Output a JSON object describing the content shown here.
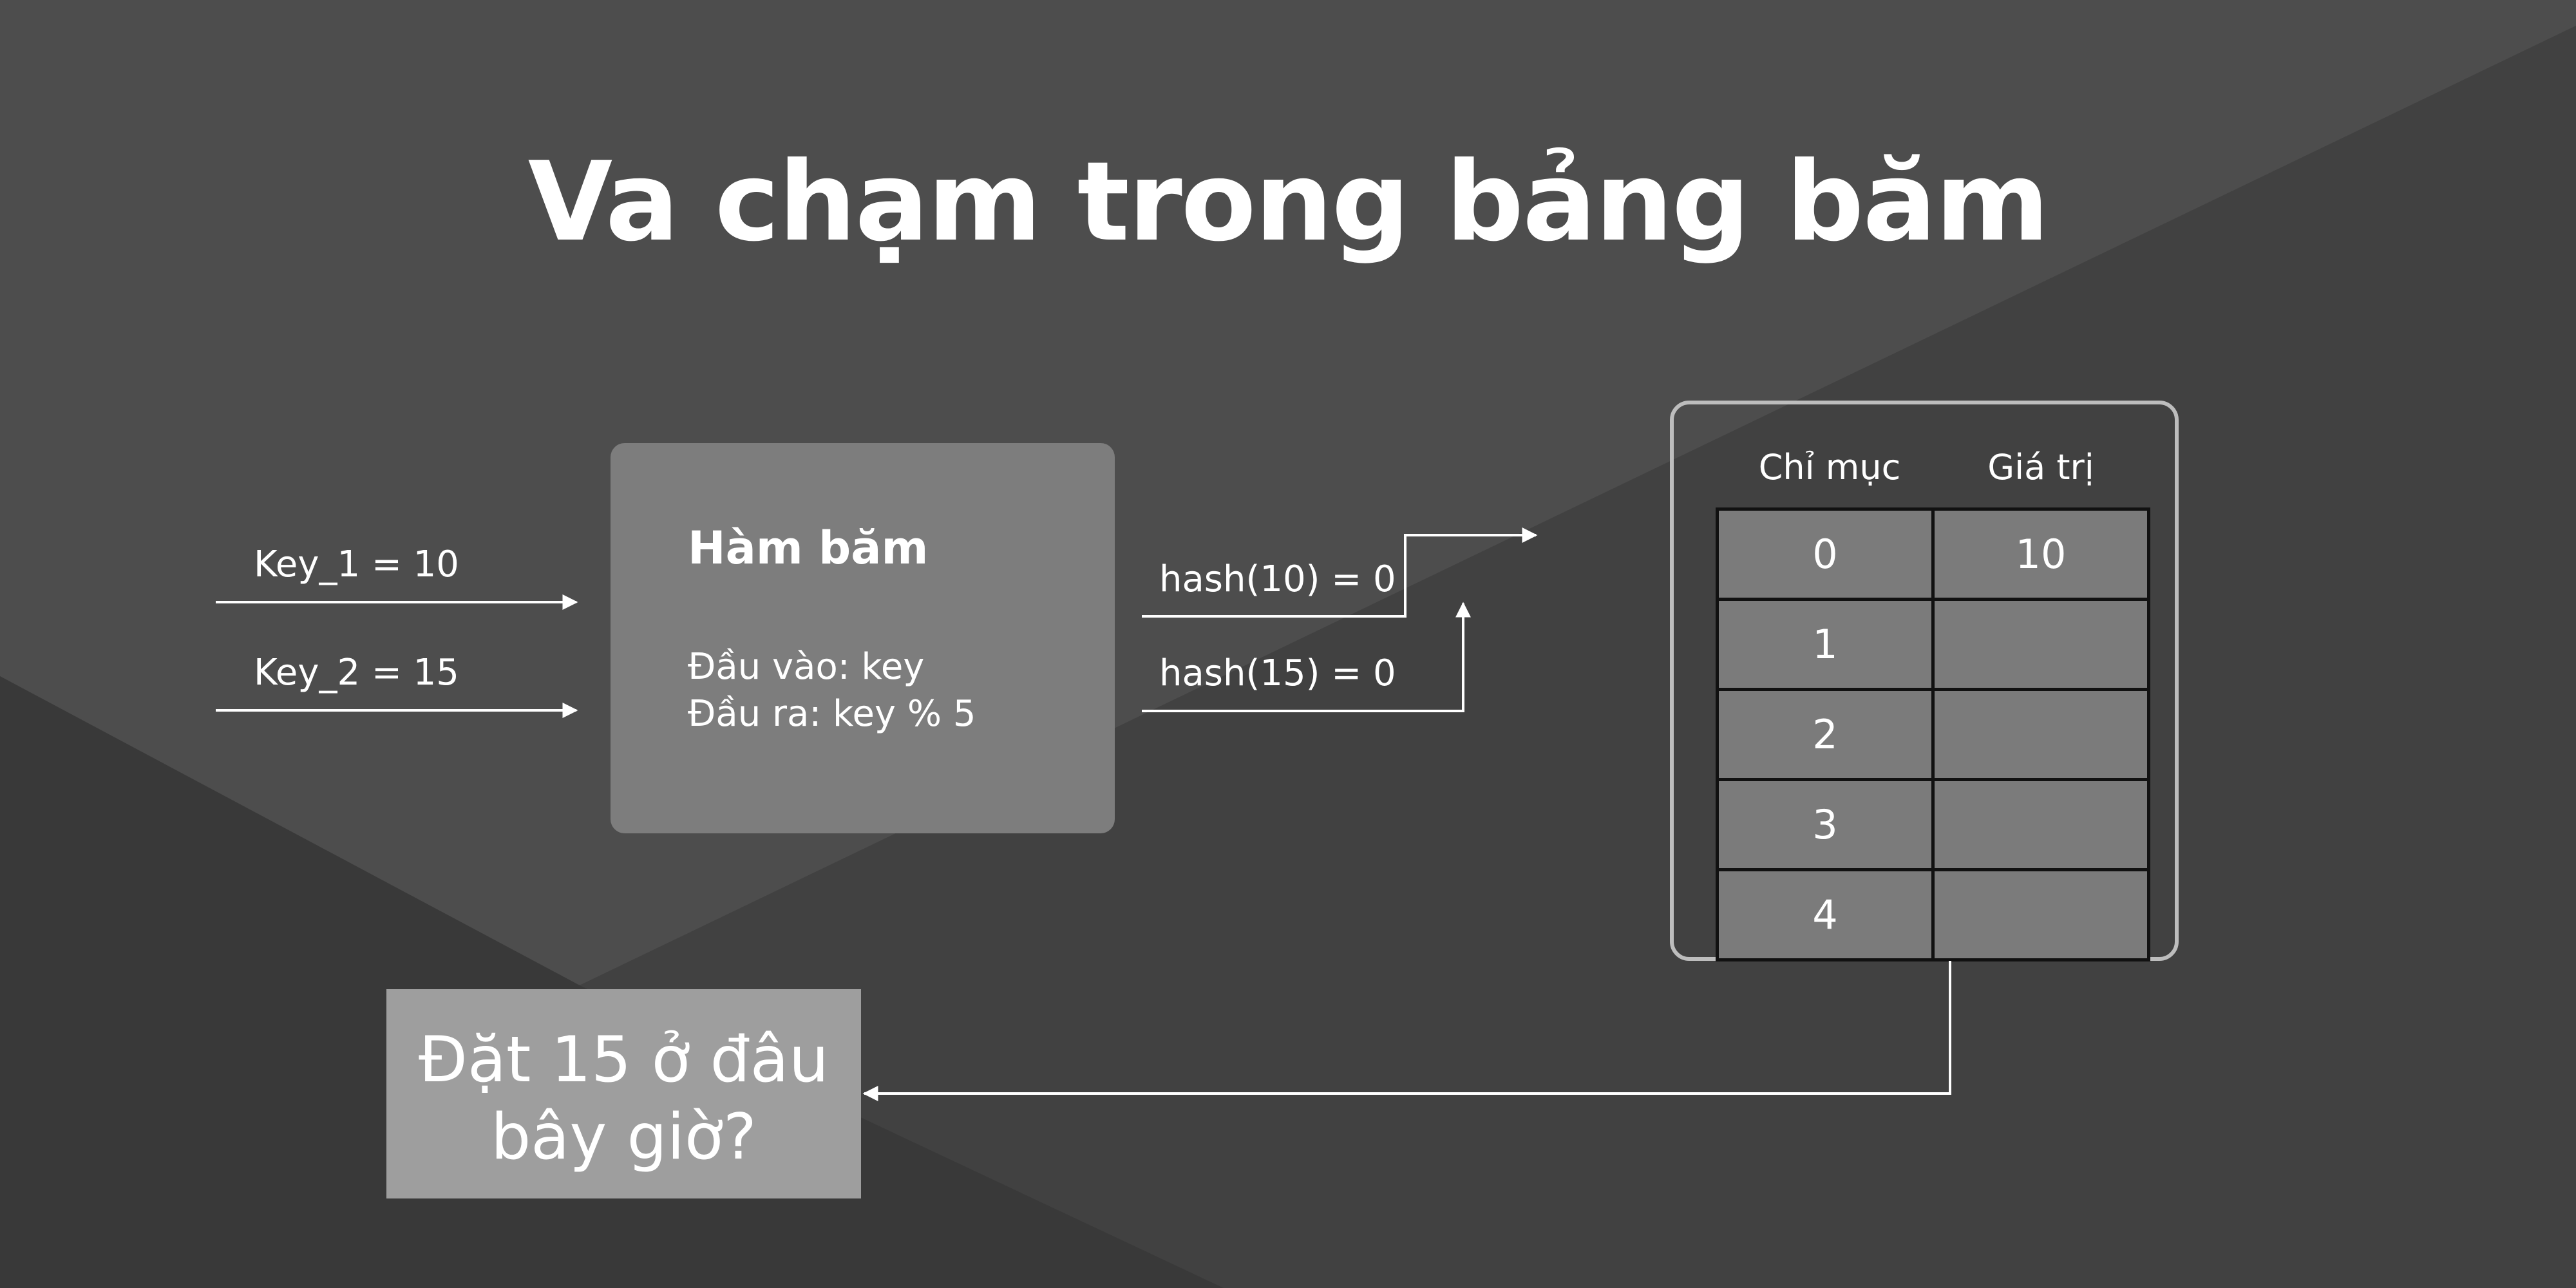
{
  "diagram": {
    "title": "Va chạm trong bảng băm",
    "inputs": [
      {
        "label": "Key_1 = 10"
      },
      {
        "label": "Key_2 = 15"
      }
    ],
    "hash_function": {
      "title": "Hàm băm",
      "input_line": "Đầu vào: key",
      "output_line": "Đầu ra: key % 5"
    },
    "hash_results": [
      {
        "label": "hash(10) = 0"
      },
      {
        "label": "hash(15) = 0"
      }
    ],
    "table": {
      "headers": {
        "index": "Chỉ mục",
        "value": "Giá trị"
      },
      "rows": [
        {
          "index": "0",
          "value": "10"
        },
        {
          "index": "1",
          "value": ""
        },
        {
          "index": "2",
          "value": ""
        },
        {
          "index": "3",
          "value": ""
        },
        {
          "index": "4",
          "value": ""
        }
      ]
    },
    "question": {
      "line1": "Đặt 15 ở đâu",
      "line2": "bây giờ?"
    },
    "colors": {
      "background": "#454545",
      "hash_box": "#7d7d7d",
      "table_cell": "#7b7b7b",
      "question_box": "#9e9e9e",
      "wire": "#ffffff"
    }
  }
}
